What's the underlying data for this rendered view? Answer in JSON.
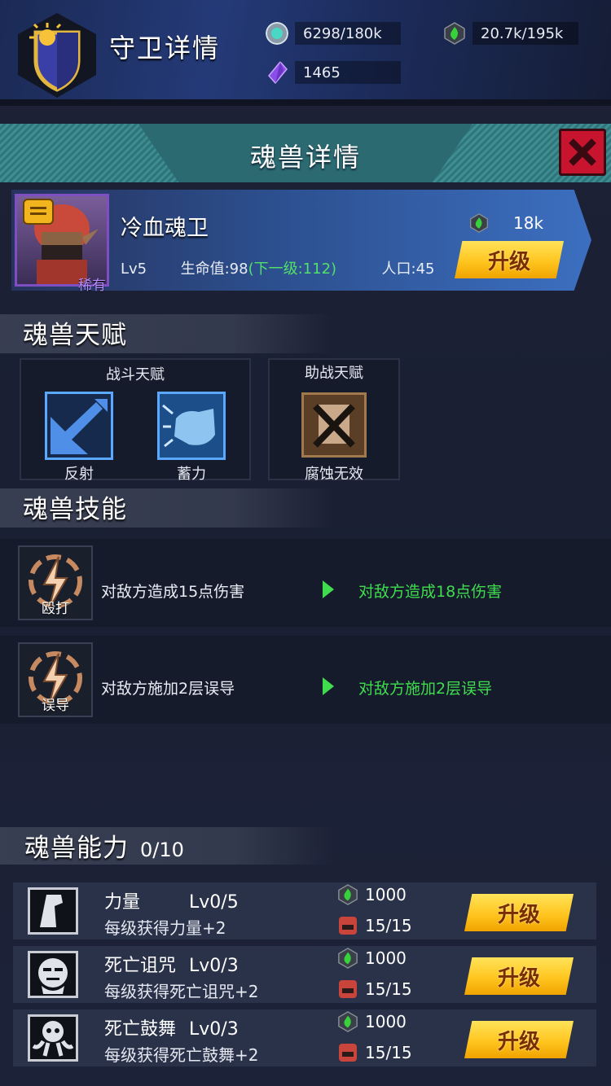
{
  "header": {
    "title": "守卫详情",
    "resources": {
      "silver": "6298/180k",
      "green_gem": "20.7k/195k",
      "crystal": "1465"
    }
  },
  "panel": {
    "title": "魂兽详情",
    "close_icon": "close-icon"
  },
  "monster": {
    "name": "冷血魂卫",
    "rarity": "稀有",
    "level": "Lv5",
    "hp_label": "生命值:98",
    "hp_next": "(下一级:112)",
    "population": "人口:45",
    "upgrade_cost": "18k",
    "upgrade_label": "升级"
  },
  "talents": {
    "section_title": "魂兽天赋",
    "combat": {
      "title": "战斗天赋",
      "items": [
        {
          "label": "反射",
          "icon": "reflect-icon"
        },
        {
          "label": "蓄力",
          "icon": "charge-icon"
        }
      ]
    },
    "support": {
      "title": "助战天赋",
      "items": [
        {
          "label": "腐蚀无效",
          "icon": "corrosion-immune-icon"
        }
      ]
    }
  },
  "skills": {
    "section_title": "魂兽技能",
    "items": [
      {
        "name": "殴打",
        "current": "对敌方造成15点伤害",
        "next": "对敌方造成18点伤害"
      },
      {
        "name": "误导",
        "current": "对敌方施加2层误导",
        "next": "对敌方施加2层误导"
      }
    ]
  },
  "abilities": {
    "section_title": "魂兽能力",
    "count": "0/10",
    "items": [
      {
        "name": "力量",
        "level": "Lv0/5",
        "desc": "每级获得力量+2",
        "cost": "1000",
        "tokens": "15/15",
        "button": "升级",
        "icon": "fist-icon"
      },
      {
        "name": "死亡诅咒",
        "level": "Lv0/3",
        "desc": "每级获得死亡诅咒+2",
        "cost": "1000",
        "tokens": "15/15",
        "button": "升级",
        "icon": "ghost-face-icon"
      },
      {
        "name": "死亡鼓舞",
        "level": "Lv0/3",
        "desc": "每级获得死亡鼓舞+2",
        "cost": "1000",
        "tokens": "15/15",
        "button": "升级",
        "icon": "skull-icon"
      }
    ]
  },
  "colors": {
    "accent_green": "#3fdc4e",
    "button_yellow": "#ffc51f",
    "close_red": "#c8142e",
    "rarity_purple": "#b58cff"
  }
}
